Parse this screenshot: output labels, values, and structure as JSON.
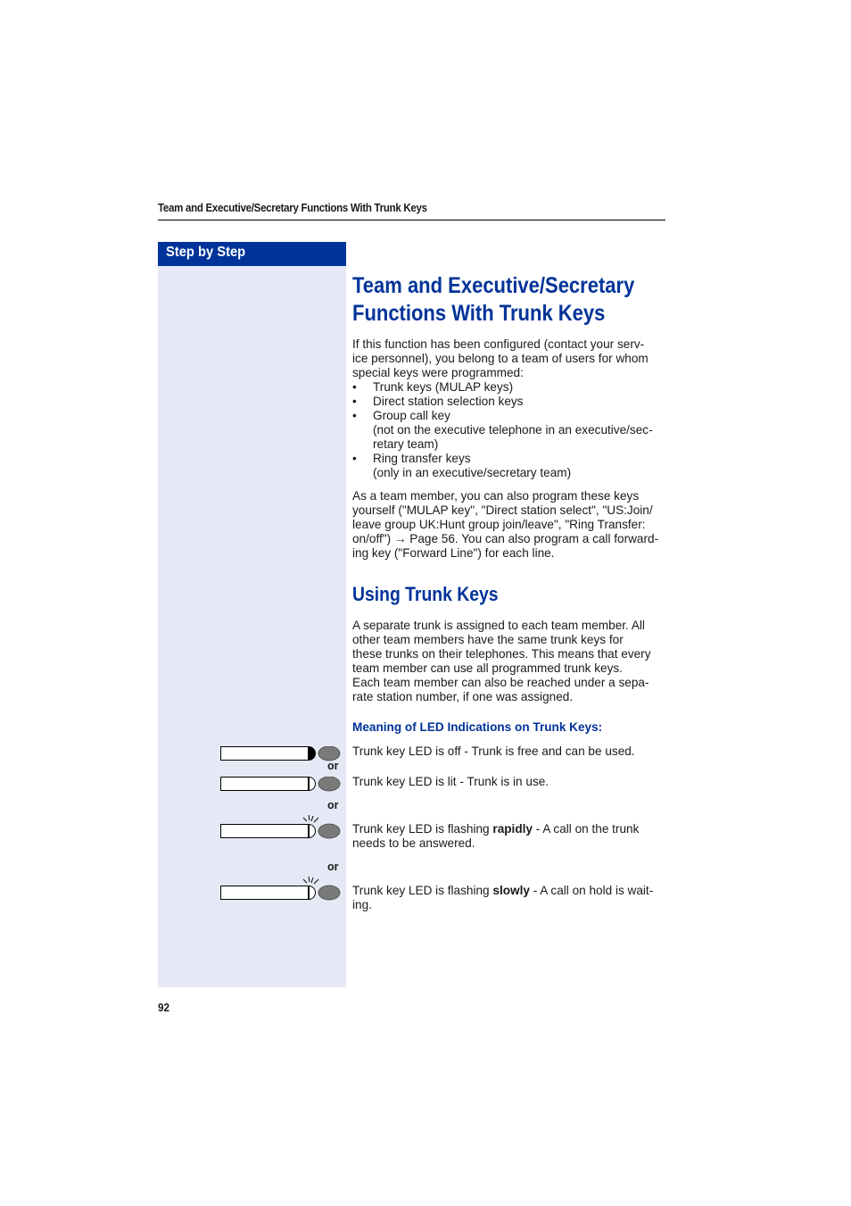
{
  "running_head": "Team and Executive/Secretary Functions With Trunk Keys",
  "sidebar": {
    "header": "Step by Step"
  },
  "main": {
    "title_lines": [
      "Team and Executive/Secretary",
      "Functions With Trunk Keys"
    ],
    "intro_lines": [
      "If this function has been configured (contact your serv-",
      "ice personnel), you belong to a team of users for whom",
      "special keys were programmed:"
    ],
    "bullets": [
      {
        "bullet": "•",
        "text": "Trunk keys (MULAP keys)",
        "sub": []
      },
      {
        "bullet": "•",
        "text": "Direct station selection keys",
        "sub": []
      },
      {
        "bullet": "•",
        "text": "Group call key",
        "sub": [
          "(not on the executive telephone in an executive/sec-",
          "retary team)"
        ]
      },
      {
        "bullet": "•",
        "text": "Ring transfer keys",
        "sub": [
          "(only in an executive/secretary team)"
        ]
      }
    ],
    "program_lines": [
      "As a team member, you can also program these keys",
      "yourself (\"MULAP key\", \"Direct station select\", \"US:Join/",
      "leave group UK:Hunt group join/leave\", \"Ring Transfer:",
      "on/off\") → Page 56. You can also program a call forward-",
      "ing key (\"Forward Line\") for each line."
    ],
    "section_title": "Using Trunk Keys",
    "section_lines": [
      "A separate trunk is assigned to each team member. All",
      "other team members have the same trunk keys for",
      "these trunks on their telephones. This means that every",
      "team member can use all programmed trunk keys.",
      "Each team member can also be reached under a sepa-",
      "rate station number, if one was assigned."
    ],
    "subsection_title": "Meaning of LED Indications on Trunk Keys:",
    "or_label": "or",
    "led_states": [
      {
        "state": "off",
        "icon": "trunk-key-led-off-icon",
        "pre": "Trunk key LED is off - Trunk is free and can be used.",
        "bold": "",
        "post": "",
        "line2": ""
      },
      {
        "state": "lit",
        "icon": "trunk-key-led-lit-icon",
        "pre": "Trunk key LED is lit - Trunk is in use.",
        "bold": "",
        "post": "",
        "line2": ""
      },
      {
        "state": "flashing-rapidly",
        "icon": "trunk-key-led-flashing-icon",
        "pre": "Trunk key LED is flashing ",
        "bold": "rapidly",
        "post": " - A call on the trunk",
        "line2": "needs to be answered."
      },
      {
        "state": "flashing-slowly",
        "icon": "trunk-key-led-flashing-icon",
        "pre": "Trunk key LED is flashing ",
        "bold": "slowly",
        "post": " - A call on hold is wait-",
        "line2": "ing."
      }
    ]
  },
  "footer": {
    "page_number": "92"
  },
  "colors": {
    "accent": "#003399",
    "sidebar_bg": "#e5e9f5",
    "key_button": "#7a7a7a"
  }
}
